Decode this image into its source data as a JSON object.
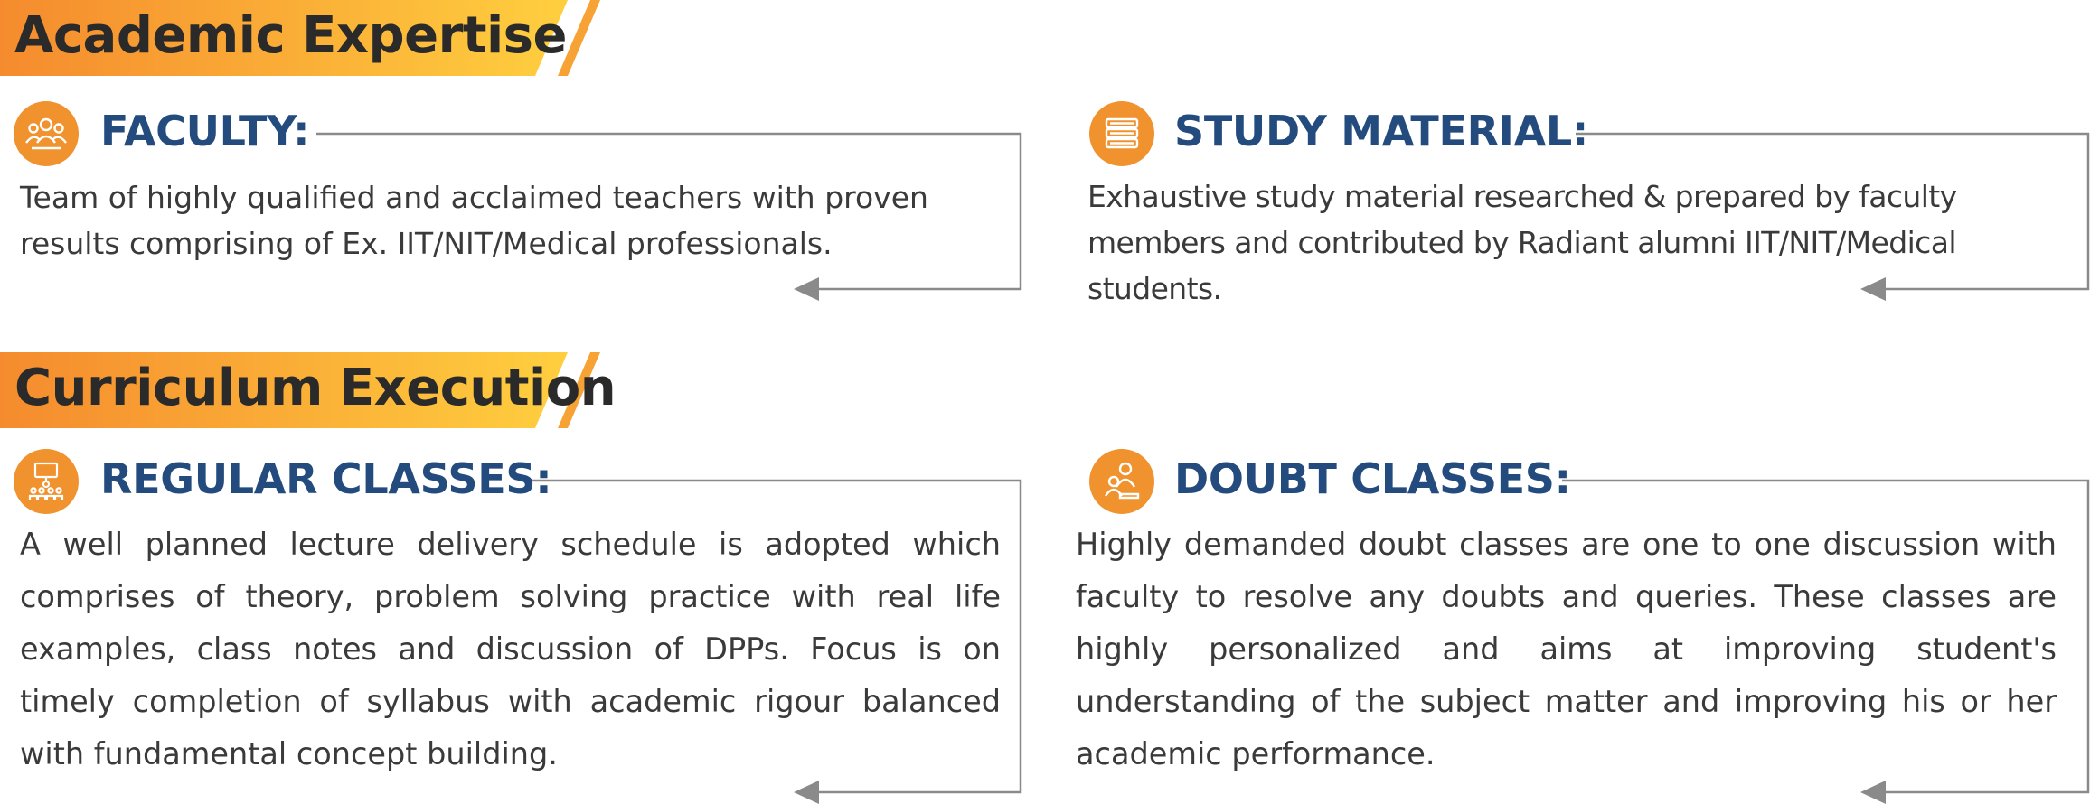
{
  "sections": [
    {
      "title": "Academic Expertise"
    },
    {
      "title": "Curriculum Execution"
    }
  ],
  "cards": {
    "faculty": {
      "icon": "group-people-icon",
      "heading": "FACULTY:",
      "text": "Team of highly qualified and acclaimed teachers with proven results comprising of Ex. IIT/NIT/Medical professionals."
    },
    "study_material": {
      "icon": "stacked-books-icon",
      "heading": "STUDY MATERIAL:",
      "text": "Exhaustive study material researched & prepared by faculty members and contributed by Radiant alumni IIT/NIT/Medical students."
    },
    "regular_classes": {
      "icon": "classroom-lecture-icon",
      "heading": "REGULAR CLASSES:",
      "text": "A well planned lecture delivery schedule is adopted which comprises of theory, problem solving practice with real life examples, class notes and discussion of DPPs. Focus is on timely completion of syllabus with academic rigour balanced with fundamental concept building."
    },
    "doubt_classes": {
      "icon": "one-to-one-discussion-icon",
      "heading": "DOUBT CLASSES:",
      "text": "Highly demanded doubt classes are one to one discussion with faculty to resolve any doubts and queries. These classes are highly personalized and aims at improving student's understanding of the subject matter and improving his or her academic performance."
    }
  },
  "colors": {
    "banner_gradient_start": "#f58b2e",
    "banner_gradient_end": "#ffcf3f",
    "heading": "#234b7e",
    "icon_background": "#f0922e",
    "body_text": "#3a3a3a",
    "connector_line": "#8a8a8a"
  }
}
